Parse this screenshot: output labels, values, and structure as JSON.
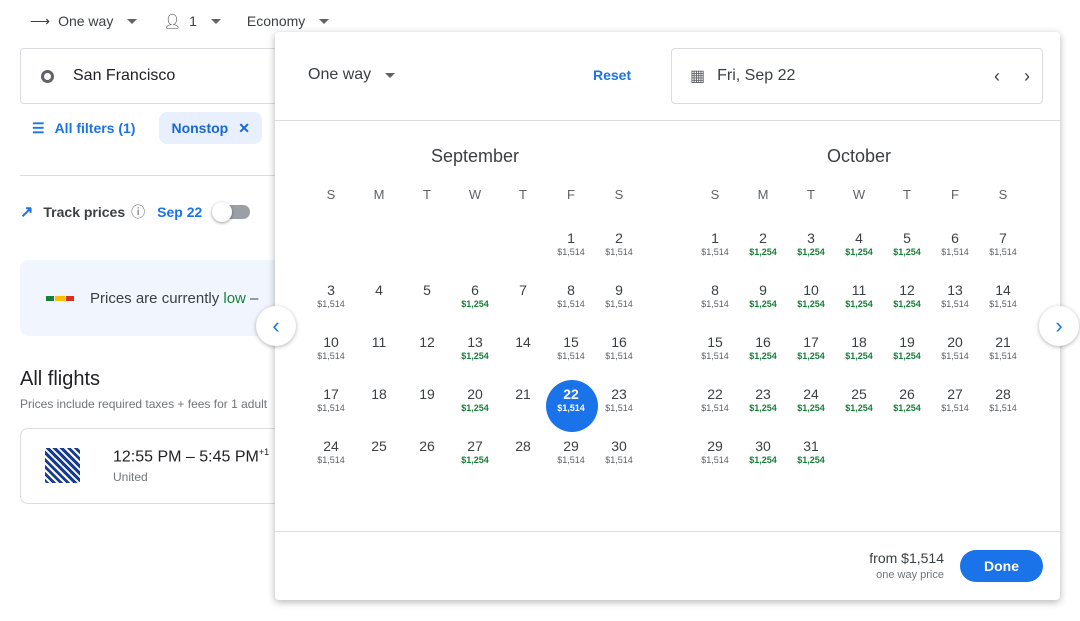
{
  "topbar": {
    "trip_type": "One way",
    "passengers": "1",
    "cabin": "Economy"
  },
  "search": {
    "origin": "San Francisco"
  },
  "filters": {
    "all_filters": "All filters (1)",
    "chip": "Nonstop"
  },
  "track": {
    "label": "Track prices",
    "date": "Sep 22",
    "enabled": false
  },
  "insight": {
    "text_pre": "Prices are currently ",
    "text_level": "low",
    "text_post": " –"
  },
  "flights": {
    "title": "All flights",
    "subtitle": "Prices include required taxes + fees for 1 adult",
    "first": {
      "times": "12:55 PM – 5:45 PM",
      "day_offset": "+1",
      "airline": "United"
    }
  },
  "picker": {
    "trip_type": "One way",
    "reset": "Reset",
    "date": "Fri, Sep 22",
    "weekdays": [
      "S",
      "M",
      "T",
      "W",
      "T",
      "F",
      "S"
    ],
    "months": [
      {
        "name": "September",
        "weeks": [
          [
            null,
            null,
            null,
            null,
            null,
            {
              "d": "1",
              "p": "$1,514"
            },
            {
              "d": "2",
              "p": "$1,514"
            }
          ],
          [
            {
              "d": "3",
              "p": "$1,514"
            },
            {
              "d": "4"
            },
            {
              "d": "5"
            },
            {
              "d": "6",
              "p": "$1,254",
              "low": true
            },
            {
              "d": "7"
            },
            {
              "d": "8",
              "p": "$1,514"
            },
            {
              "d": "9",
              "p": "$1,514"
            }
          ],
          [
            {
              "d": "10",
              "p": "$1,514"
            },
            {
              "d": "11"
            },
            {
              "d": "12"
            },
            {
              "d": "13",
              "p": "$1,254",
              "low": true
            },
            {
              "d": "14"
            },
            {
              "d": "15",
              "p": "$1,514"
            },
            {
              "d": "16",
              "p": "$1,514"
            }
          ],
          [
            {
              "d": "17",
              "p": "$1,514"
            },
            {
              "d": "18"
            },
            {
              "d": "19"
            },
            {
              "d": "20",
              "p": "$1,254",
              "low": true
            },
            {
              "d": "21"
            },
            {
              "d": "22",
              "p": "$1,514",
              "selected": true
            },
            {
              "d": "23",
              "p": "$1,514"
            }
          ],
          [
            {
              "d": "24",
              "p": "$1,514"
            },
            {
              "d": "25"
            },
            {
              "d": "26"
            },
            {
              "d": "27",
              "p": "$1,254",
              "low": true
            },
            {
              "d": "28"
            },
            {
              "d": "29",
              "p": "$1,514"
            },
            {
              "d": "30",
              "p": "$1,514"
            }
          ]
        ]
      },
      {
        "name": "October",
        "weeks": [
          [
            {
              "d": "1",
              "p": "$1,514"
            },
            {
              "d": "2",
              "p": "$1,254",
              "low": true
            },
            {
              "d": "3",
              "p": "$1,254",
              "low": true
            },
            {
              "d": "4",
              "p": "$1,254",
              "low": true
            },
            {
              "d": "5",
              "p": "$1,254",
              "low": true
            },
            {
              "d": "6",
              "p": "$1,514"
            },
            {
              "d": "7",
              "p": "$1,514"
            }
          ],
          [
            {
              "d": "8",
              "p": "$1,514"
            },
            {
              "d": "9",
              "p": "$1,254",
              "low": true
            },
            {
              "d": "10",
              "p": "$1,254",
              "low": true
            },
            {
              "d": "11",
              "p": "$1,254",
              "low": true
            },
            {
              "d": "12",
              "p": "$1,254",
              "low": true
            },
            {
              "d": "13",
              "p": "$1,514"
            },
            {
              "d": "14",
              "p": "$1,514"
            }
          ],
          [
            {
              "d": "15",
              "p": "$1,514"
            },
            {
              "d": "16",
              "p": "$1,254",
              "low": true
            },
            {
              "d": "17",
              "p": "$1,254",
              "low": true
            },
            {
              "d": "18",
              "p": "$1,254",
              "low": true
            },
            {
              "d": "19",
              "p": "$1,254",
              "low": true
            },
            {
              "d": "20",
              "p": "$1,514"
            },
            {
              "d": "21",
              "p": "$1,514"
            }
          ],
          [
            {
              "d": "22",
              "p": "$1,514"
            },
            {
              "d": "23",
              "p": "$1,254",
              "low": true
            },
            {
              "d": "24",
              "p": "$1,254",
              "low": true
            },
            {
              "d": "25",
              "p": "$1,254",
              "low": true
            },
            {
              "d": "26",
              "p": "$1,254",
              "low": true
            },
            {
              "d": "27",
              "p": "$1,514"
            },
            {
              "d": "28",
              "p": "$1,514"
            }
          ],
          [
            {
              "d": "29",
              "p": "$1,514"
            },
            {
              "d": "30",
              "p": "$1,254",
              "low": true
            },
            {
              "d": "31",
              "p": "$1,254",
              "low": true
            },
            null,
            null,
            null,
            null
          ]
        ]
      }
    ],
    "from_price": "from $1,514",
    "price_note": "one way price",
    "done": "Done"
  },
  "colors": {
    "accent": "#1a73e8",
    "low_price": "#188038",
    "selected": "#1a73e8"
  }
}
